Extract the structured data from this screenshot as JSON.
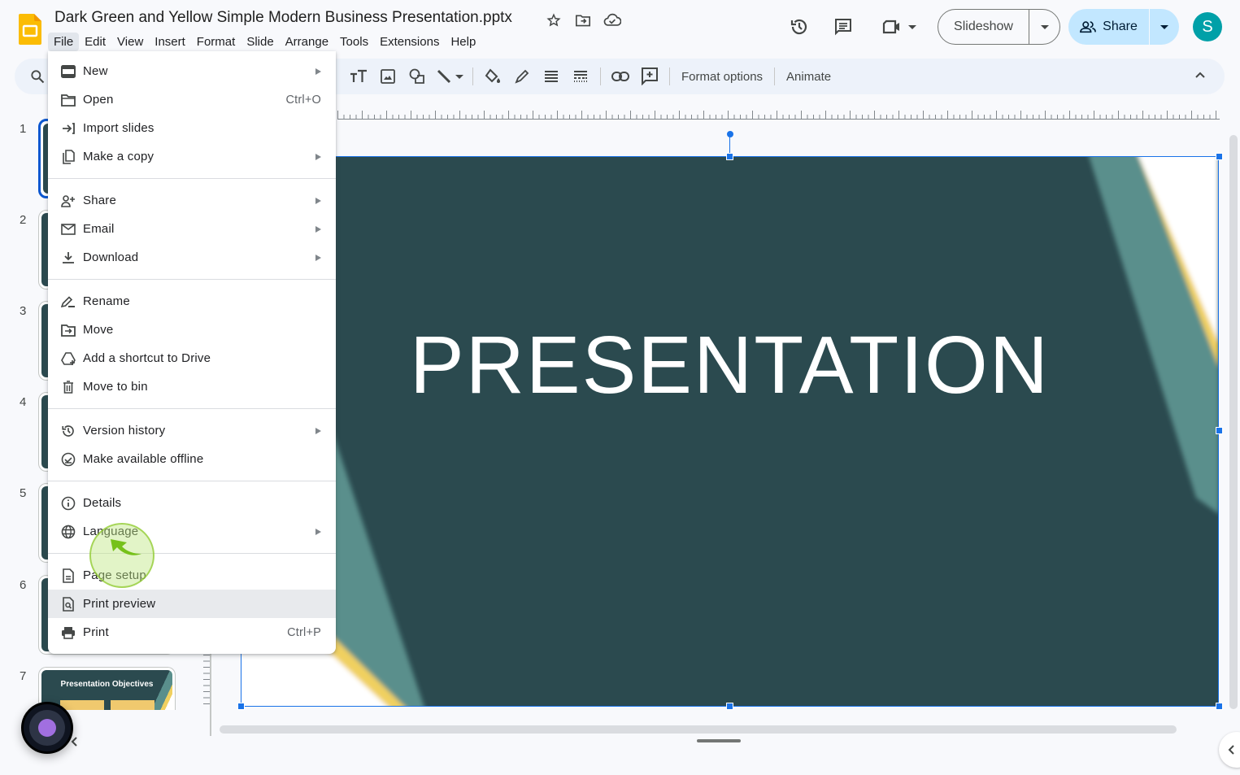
{
  "app": {
    "document_title": "Dark Green and Yellow Simple Modern Business Presentation.pptx",
    "title_icons": [
      "star-icon",
      "move-to-folder-icon",
      "cloud-saved-icon"
    ]
  },
  "menubar": {
    "items": [
      "File",
      "Edit",
      "View",
      "Insert",
      "Format",
      "Slide",
      "Arrange",
      "Tools",
      "Extensions",
      "Help"
    ],
    "active": "File"
  },
  "header": {
    "slideshow_label": "Slideshow",
    "share_label": "Share",
    "avatar_initial": "S",
    "avatar_color": "#00a0a8",
    "share_bg_color": "#c2e7ff"
  },
  "toolbar": {
    "format_options_label": "Format options",
    "animate_label": "Animate"
  },
  "filmstrip": {
    "slides": [
      {
        "number": "1",
        "selected": true
      },
      {
        "number": "2"
      },
      {
        "number": "3"
      },
      {
        "number": "4"
      },
      {
        "number": "5"
      },
      {
        "number": "6"
      },
      {
        "number": "7",
        "title": "Presentation Objectives"
      }
    ]
  },
  "slide": {
    "title": "PRESENTATION",
    "bg_color": "#2b4a4f",
    "accent_teal": "#5a8f8c",
    "accent_yellow": "#f0d060"
  },
  "file_menu": {
    "groups": [
      [
        {
          "label": "New",
          "icon": "new-slides-icon",
          "submenu": true
        },
        {
          "label": "Open",
          "icon": "folder-icon",
          "shortcut": "Ctrl+O"
        },
        {
          "label": "Import slides",
          "icon": "import-icon"
        },
        {
          "label": "Make a copy",
          "icon": "copy-icon",
          "submenu": true
        }
      ],
      [
        {
          "label": "Share",
          "icon": "person-add-icon",
          "submenu": true
        },
        {
          "label": "Email",
          "icon": "email-icon",
          "submenu": true
        },
        {
          "label": "Download",
          "icon": "download-icon",
          "submenu": true
        }
      ],
      [
        {
          "label": "Rename",
          "icon": "rename-icon"
        },
        {
          "label": "Move",
          "icon": "move-folder-icon"
        },
        {
          "label": "Add a shortcut to Drive",
          "icon": "drive-shortcut-icon"
        },
        {
          "label": "Move to bin",
          "icon": "trash-icon"
        }
      ],
      [
        {
          "label": "Version history",
          "icon": "history-icon",
          "submenu": true
        },
        {
          "label": "Make available offline",
          "icon": "offline-icon"
        }
      ],
      [
        {
          "label": "Details",
          "icon": "info-icon"
        },
        {
          "label": "Language",
          "icon": "globe-icon",
          "submenu": true
        }
      ],
      [
        {
          "label": "Page setup",
          "icon": "page-icon"
        },
        {
          "label": "Print preview",
          "icon": "print-preview-icon",
          "hover": true
        },
        {
          "label": "Print",
          "icon": "printer-icon",
          "shortcut": "Ctrl+P"
        }
      ]
    ]
  }
}
